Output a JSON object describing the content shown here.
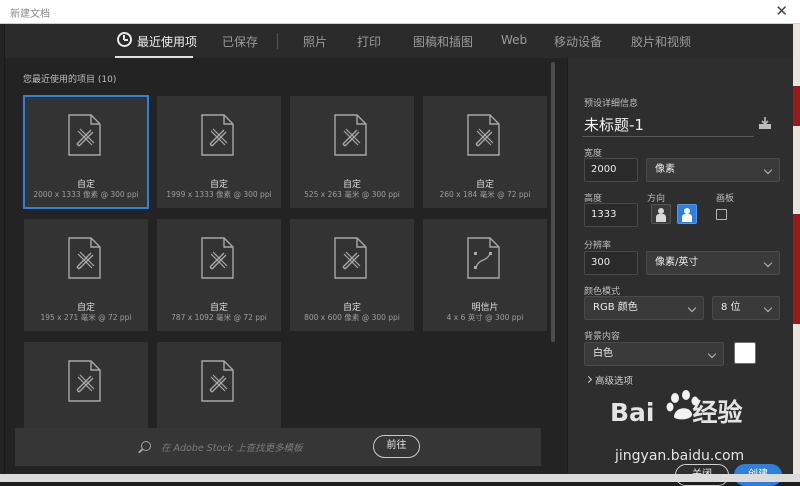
{
  "window": {
    "title": "新建文档",
    "close_glyph": "✕"
  },
  "tabs": [
    {
      "label": "最近使用项",
      "active": true
    },
    {
      "label": "已保存",
      "active": false
    },
    {
      "label": "照片",
      "active": false
    },
    {
      "label": "打印",
      "active": false
    },
    {
      "label": "图稿和插图",
      "active": false
    },
    {
      "label": "Web",
      "active": false
    },
    {
      "label": "移动设备",
      "active": false
    },
    {
      "label": "胶片和视频",
      "active": false
    }
  ],
  "recent": {
    "title": "您最近使用的项目",
    "count": "(10)",
    "items": [
      {
        "name": "自定",
        "dim": "2000 x 1333 像素 @ 300 ppi",
        "selected": true,
        "icon": "brush-doc-icon"
      },
      {
        "name": "自定",
        "dim": "1999 x 1333 像素 @ 300 ppi",
        "icon": "brush-doc-icon"
      },
      {
        "name": "自定",
        "dim": "525 x 263 毫米 @ 300 ppi",
        "icon": "brush-doc-icon"
      },
      {
        "name": "自定",
        "dim": "260 x 184 毫米 @ 72 ppi",
        "icon": "brush-doc-icon"
      },
      {
        "name": "自定",
        "dim": "195 x 271 毫米 @ 72 ppi",
        "icon": "brush-doc-icon"
      },
      {
        "name": "自定",
        "dim": "787 x 1092 毫米 @ 72 ppi",
        "icon": "brush-doc-icon"
      },
      {
        "name": "自定",
        "dim": "800 x 600 像素 @ 300 ppi",
        "icon": "brush-doc-icon"
      },
      {
        "name": "明信片",
        "dim": "4 x 6 英寸 @ 300 ppi",
        "icon": "postcard-doc-icon"
      },
      {
        "name": "",
        "dim": "",
        "icon": "brush-doc-icon"
      },
      {
        "name": "",
        "dim": "",
        "icon": "brush-doc-icon"
      }
    ]
  },
  "stock": {
    "placeholder": "在 Adobe Stock 上查找更多模板",
    "go_label": "前往"
  },
  "details": {
    "section_title": "预设详细信息",
    "doc_name": "未标题-1",
    "width_label": "宽度",
    "width_value": "2000",
    "width_unit": "像素",
    "height_label": "高度",
    "height_value": "1333",
    "orientation_label": "方向",
    "artboard_label": "画板",
    "resolution_label": "分辨率",
    "resolution_value": "300",
    "resolution_unit": "像素/英寸",
    "color_mode_label": "颜色模式",
    "color_mode": "RGB 颜色",
    "bit_depth": "8 位",
    "background_label": "背景内容",
    "background": "白色",
    "background_color": "#ffffff",
    "advanced_label": "高级选项",
    "close_label": "关闭",
    "create_label": "创建"
  },
  "watermark": {
    "brand": "Bai",
    "brand2": "经验",
    "url": "jingyan.baidu.com"
  },
  "colors": {
    "accent": "#2d7fe0",
    "panel": "#2e2e2e",
    "card": "#333333"
  }
}
